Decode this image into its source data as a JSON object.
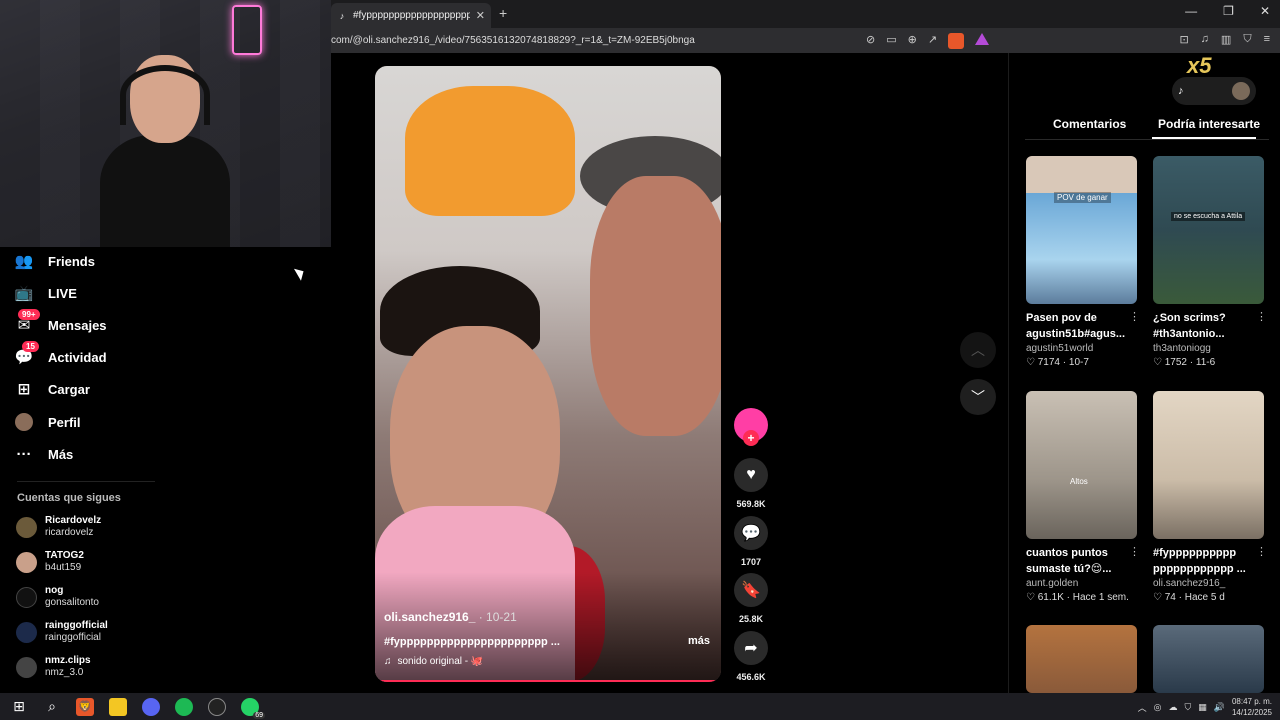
{
  "browser": {
    "tab_title": "#fyppppppppppppppppppppp",
    "url": "com/@oli.sanchez916_/video/7563516132074818829?_r=1&_t=ZM-92EB5j0bnga",
    "new_tab": "+",
    "close_tab": "✕",
    "window_controls": [
      "—",
      "❐",
      "✕"
    ]
  },
  "sidebar": {
    "items": [
      {
        "label": "Friends",
        "icon": "friends-icon",
        "glyph": "👥"
      },
      {
        "label": "LIVE",
        "icon": "live-icon",
        "glyph": "📺"
      },
      {
        "label": "Mensajes",
        "icon": "messages-icon",
        "glyph": "✉",
        "badge": "99+"
      },
      {
        "label": "Actividad",
        "icon": "activity-icon",
        "glyph": "💬",
        "badge": "15"
      },
      {
        "label": "Cargar",
        "icon": "upload-icon",
        "glyph": "⊞"
      },
      {
        "label": "Perfil",
        "icon": "profile-icon",
        "glyph": ""
      },
      {
        "label": "Más",
        "icon": "more-icon",
        "glyph": "···"
      }
    ],
    "following_title": "Cuentas que sigues",
    "following": [
      {
        "name": "Ricardovelz",
        "handle": "ricardovelz"
      },
      {
        "name": "TATOG2",
        "handle": "b4ut159"
      },
      {
        "name": "nog",
        "handle": "gonsalitonto"
      },
      {
        "name": "rainggofficial",
        "handle": "rainggofficial"
      },
      {
        "name": "nmz.clips",
        "handle": "nmz_3.0"
      }
    ]
  },
  "video": {
    "username": "oli.sanchez916_",
    "date": " · 10-21",
    "description": "#fypppppppppppppppppppppp ...",
    "more_label": "más",
    "sound": "sonido original - 🐙"
  },
  "actions": {
    "likes": "569.8K",
    "comments": "1707",
    "saves": "25.8K",
    "shares": "456.6K"
  },
  "panel": {
    "tab_comments": "Comentarios",
    "tab_suggested": "Podría interesarte",
    "overlay": "x5",
    "cards": [
      {
        "title": "Pasen pov de agustin51b#agus...",
        "user": "agustin51world",
        "meta": "♡ 7174 · 10-7",
        "thumb_color": "#6aa7d6",
        "caption": "POV de ganar"
      },
      {
        "title": "¿Son scrims? #th3antonio...",
        "user": "th3antoniogg",
        "meta": "♡ 1752 · 11-6",
        "thumb_color": "#2f4a52",
        "caption": "no se escucha a Attila"
      },
      {
        "title": "cuantos puntos sumaste tú?😌...",
        "user": "aunt.golden",
        "meta": "♡ 61.1K · Hace 1 sem.",
        "thumb_color": "#bdb2a6",
        "caption": "Altos"
      },
      {
        "title": "#fypppppppppp pppppppppppp ...",
        "user": "oli.sanchez916_",
        "meta": "♡ 74 · Hace 5 d",
        "thumb_color": "#d9cbb8",
        "caption": ""
      },
      {
        "title": "",
        "user": "",
        "meta": "",
        "thumb_color": "#8a5a3a",
        "caption": ""
      },
      {
        "title": "",
        "user": "",
        "meta": "",
        "thumb_color": "#3a4a5a",
        "caption": ""
      }
    ]
  },
  "taskbar": {
    "time": "08:47 p. m.",
    "date": "14/12/2025",
    "whatsapp_badge": "69"
  }
}
